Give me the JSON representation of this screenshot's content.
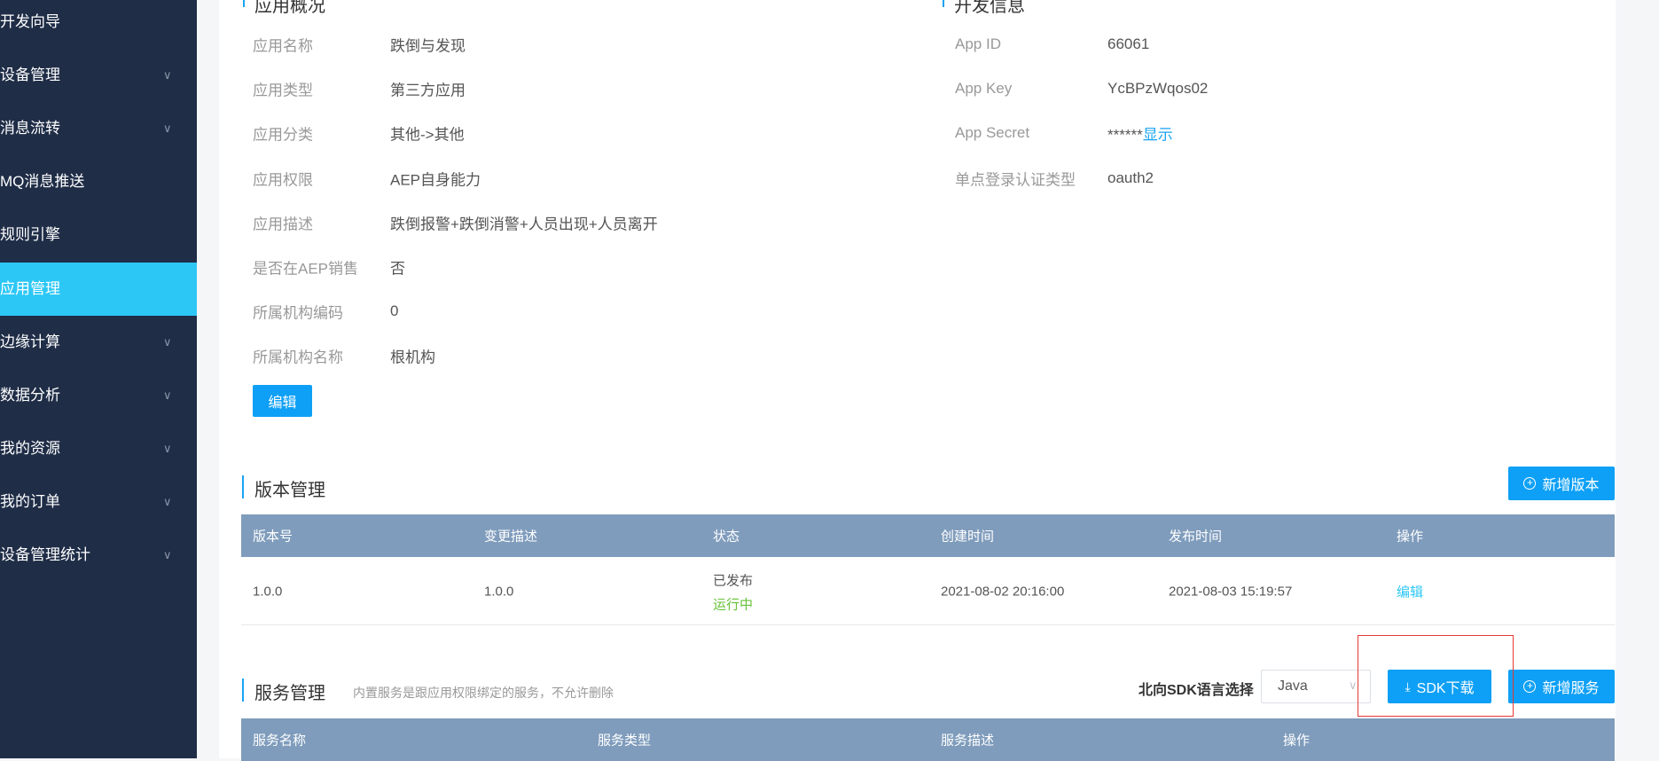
{
  "sidebar": {
    "items": [
      {
        "label": "开发向导",
        "chevron": false
      },
      {
        "label": "设备管理",
        "chevron": true
      },
      {
        "label": "消息流转",
        "chevron": true
      },
      {
        "label": "MQ消息推送",
        "chevron": false
      },
      {
        "label": "规则引擎",
        "chevron": false
      },
      {
        "label": "应用管理",
        "chevron": false,
        "active": true
      },
      {
        "label": "边缘计算",
        "chevron": true
      },
      {
        "label": "数据分析",
        "chevron": true
      },
      {
        "label": "我的资源",
        "chevron": true
      },
      {
        "label": "我的订单",
        "chevron": true
      },
      {
        "label": "设备管理统计",
        "chevron": true
      }
    ]
  },
  "overview": {
    "title": "应用概况",
    "rows": [
      {
        "label": "应用名称",
        "value": "跌倒与发现"
      },
      {
        "label": "应用类型",
        "value": "第三方应用"
      },
      {
        "label": "应用分类",
        "value": "其他->其他"
      },
      {
        "label": "应用权限",
        "value": "AEP自身能力"
      },
      {
        "label": "应用描述",
        "value": "跌倒报警+跌倒消警+人员出现+人员离开"
      },
      {
        "label": "是否在AEP销售",
        "value": "否"
      },
      {
        "label": "所属机构编码",
        "value": "0"
      },
      {
        "label": "所属机构名称",
        "value": "根机构"
      }
    ],
    "edit_label": "编辑"
  },
  "dev": {
    "title": "开发信息",
    "rows": [
      {
        "label": "App ID",
        "value": "66061"
      },
      {
        "label": "App Key",
        "value": "YcBPzWqos02"
      },
      {
        "label": "App Secret",
        "value": "******",
        "link": "显示"
      },
      {
        "label": "单点登录认证类型",
        "value": "oauth2"
      }
    ]
  },
  "versions": {
    "title": "版本管理",
    "add_label": "新增版本",
    "columns": [
      "版本号",
      "变更描述",
      "状态",
      "创建时间",
      "发布时间",
      "操作"
    ],
    "rows": [
      {
        "version": "1.0.0",
        "desc": "1.0.0",
        "status": "已发布",
        "run_status": "运行中",
        "created": "2021-08-02 20:16:00",
        "published": "2021-08-03 15:19:57",
        "action": "编辑"
      }
    ]
  },
  "services": {
    "title": "服务管理",
    "note": "内置服务是跟应用权限绑定的服务，不允许删除",
    "sdk_label": "北向SDK语言选择",
    "sdk_lang": "Java",
    "sdk_download": "SDK下载",
    "add_label": "新增服务",
    "columns": [
      "服务名称",
      "服务类型",
      "服务描述",
      "操作"
    ]
  },
  "colors": {
    "sidebar": "#1f2d47",
    "active": "#2dc7f6",
    "primary": "#0ea0f6",
    "table_header": "#7f9cbc",
    "running": "#67c23a",
    "highlight": "#e53935"
  }
}
